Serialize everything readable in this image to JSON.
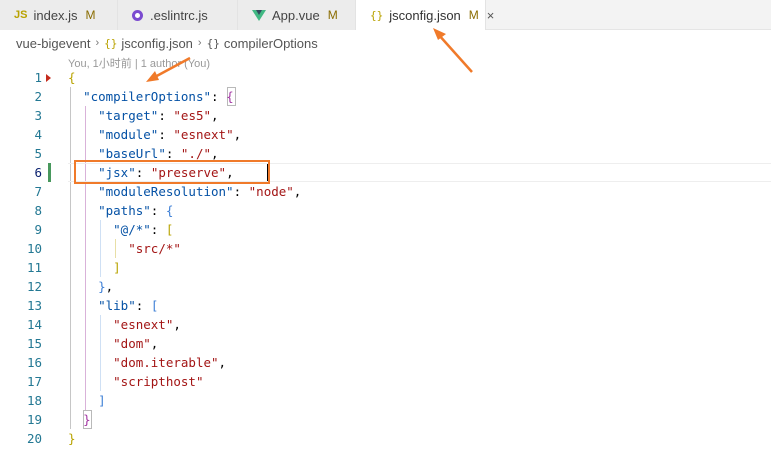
{
  "tabs": [
    {
      "icon_text": "JS",
      "icon": "js-file-icon",
      "label": "index.js",
      "status": "M",
      "active": false
    },
    {
      "icon": "eslint-icon",
      "label": ".eslintrc.js",
      "active": false
    },
    {
      "icon": "vue-icon",
      "label": "App.vue",
      "status": "M",
      "active": false
    },
    {
      "icon_text": "{}",
      "icon": "json-icon",
      "label": "jsconfig.json",
      "status": "M",
      "close": "×",
      "active": true
    }
  ],
  "breadcrumb": {
    "folder": "vue-bigevent",
    "sep": "›",
    "file_icon": "{}",
    "file": "jsconfig.json",
    "obj_icon": "{}",
    "symbol": "compilerOptions"
  },
  "codelens": "You, 1小时前 | 1 author (You)",
  "line_numbers": [
    "1",
    "2",
    "3",
    "4",
    "5",
    "6",
    "7",
    "8",
    "9",
    "10",
    "11",
    "12",
    "13",
    "14",
    "15",
    "16",
    "17",
    "18",
    "19",
    "20"
  ],
  "code": {
    "l1": "{",
    "l2_key": "\"compilerOptions\"",
    "l2_colon": ": ",
    "l2_open": "{",
    "l3_key": "\"target\"",
    "l3_colon": ": ",
    "l3_val": "\"es5\"",
    "l3_comma": ",",
    "l4_key": "\"module\"",
    "l4_colon": ": ",
    "l4_val": "\"esnext\"",
    "l4_comma": ",",
    "l5_key": "\"baseUrl\"",
    "l5_colon": ": ",
    "l5_val": "\"./\"",
    "l5_comma": ",",
    "l6_key": "\"jsx\"",
    "l6_colon": ": ",
    "l6_val": "\"preserve\"",
    "l6_comma": ",",
    "l7_key": "\"moduleResolution\"",
    "l7_colon": ": ",
    "l7_val": "\"node\"",
    "l7_comma": ",",
    "l8_key": "\"paths\"",
    "l8_colon": ": ",
    "l8_open": "{",
    "l9_key": "\"@/*\"",
    "l9_colon": ": ",
    "l9_open": "[",
    "l10_val": "\"src/*\"",
    "l11_close": "]",
    "l12_close": "}",
    "l12_comma": ",",
    "l13_key": "\"lib\"",
    "l13_colon": ": ",
    "l13_open": "[",
    "l14_val": "\"esnext\"",
    "l14_comma": ",",
    "l15_val": "\"dom\"",
    "l15_comma": ",",
    "l16_val": "\"dom.iterable\"",
    "l16_comma": ",",
    "l17_val": "\"scripthost\"",
    "l18_close": "]",
    "l19_close": "}",
    "l20": "}"
  },
  "colors": {
    "accent_annotation": "#f07a2a",
    "key": "#0451a5",
    "string": "#a31515",
    "modified": "#48985d"
  }
}
